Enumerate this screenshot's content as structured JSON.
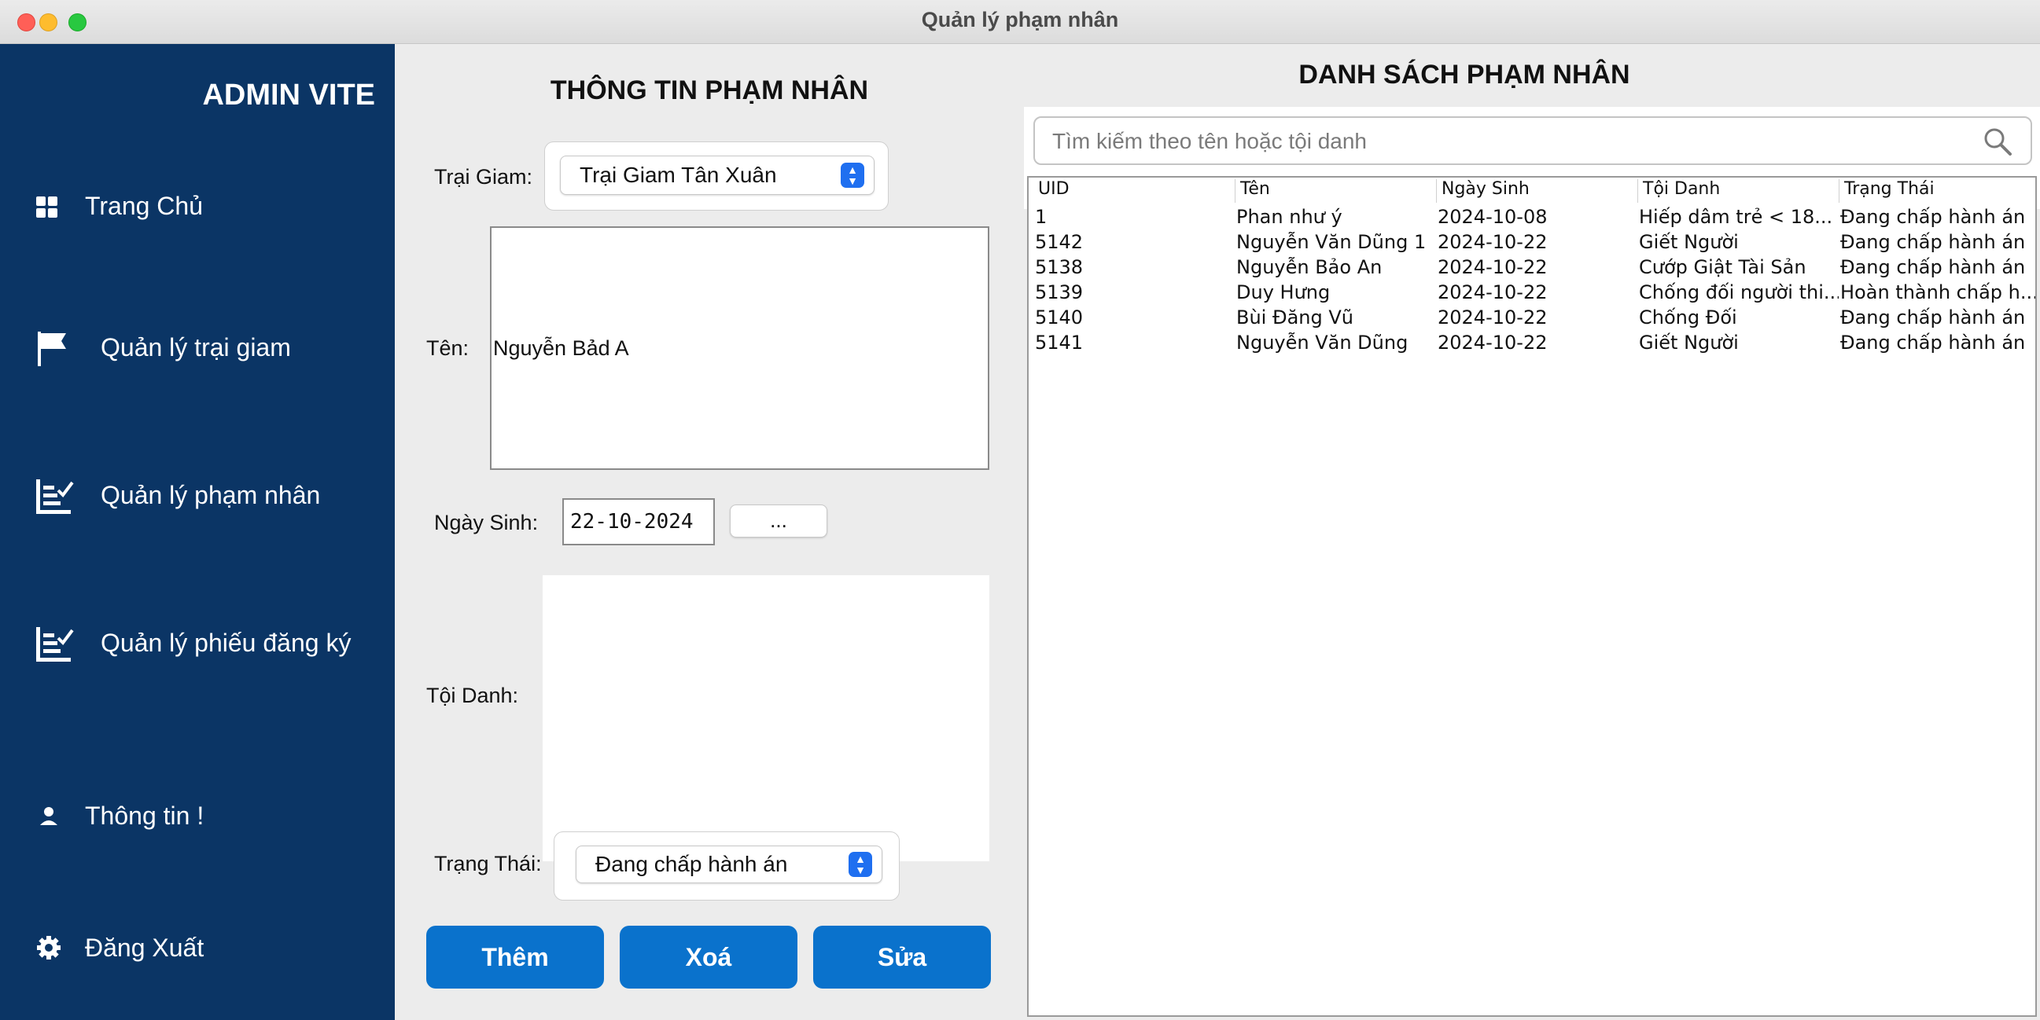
{
  "window": {
    "title": "Quản lý phạm nhân"
  },
  "sidebar": {
    "brand": "ADMIN VITE",
    "items": [
      {
        "label": "Trang Chủ",
        "icon": "grid-icon"
      },
      {
        "label": "Quản lý trại giam",
        "icon": "flag-icon"
      },
      {
        "label": "Quản lý phạm nhân",
        "icon": "checklist-icon"
      },
      {
        "label": "Quản lý phiếu đăng ký",
        "icon": "checklist-icon"
      },
      {
        "label": "Thông tin !",
        "icon": "user-icon"
      },
      {
        "label": "Đăng Xuất",
        "icon": "gear-icon"
      }
    ]
  },
  "form": {
    "title": "THÔNG TIN PHẠM NHÂN",
    "trai_giam_label": "Trại Giam:",
    "trai_giam_value": "Trại Giam Tân Xuân",
    "ten_label": "Tên:",
    "ten_value": "Nguyễn Bảd A",
    "ngay_sinh_label": "Ngày Sinh:",
    "ngay_sinh_value": "22-10-2024",
    "picker_label": "...",
    "toi_danh_label": "Tội Danh:",
    "toi_danh_value": "",
    "trang_thai_label": "Trạng Thái:",
    "trang_thai_value": "Đang chấp hành án",
    "buttons": {
      "add": "Thêm",
      "delete": "Xoá",
      "edit": "Sửa"
    }
  },
  "list": {
    "title": "DANH SÁCH PHẠM NHÂN",
    "search_placeholder": "Tìm kiếm theo tên hoặc tội danh",
    "columns": [
      "UID",
      "Tên",
      "Ngày Sinh",
      "Tội Danh",
      "Trạng Thái"
    ],
    "rows": [
      [
        "1",
        "Phan như ý",
        "2024-10-08",
        "Hiếp dâm trẻ < 18...",
        "Đang chấp hành án"
      ],
      [
        "5142",
        "Nguyễn Văn Dũng 1",
        "2024-10-22",
        "Giết Người",
        "Đang chấp hành án"
      ],
      [
        "5138",
        "Nguyễn Bảo An",
        "2024-10-22",
        "Cướp Giật Tài Sản",
        "Đang chấp hành án"
      ],
      [
        "5139",
        "Duy Hưng",
        "2024-10-22",
        "Chống đối người thi...",
        "Hoàn thành chấp h..."
      ],
      [
        "5140",
        "Bùi Đăng Vũ",
        "2024-10-22",
        "Chống Đối",
        "Đang chấp hành án"
      ],
      [
        "5141",
        "Nguyễn Văn Dũng",
        "2024-10-22",
        "Giết Người",
        "Đang chấp hành án"
      ]
    ]
  },
  "colors": {
    "sidebar": "#0b3565",
    "button": "#0a72cc",
    "select_accent": "#1f6ff0"
  }
}
